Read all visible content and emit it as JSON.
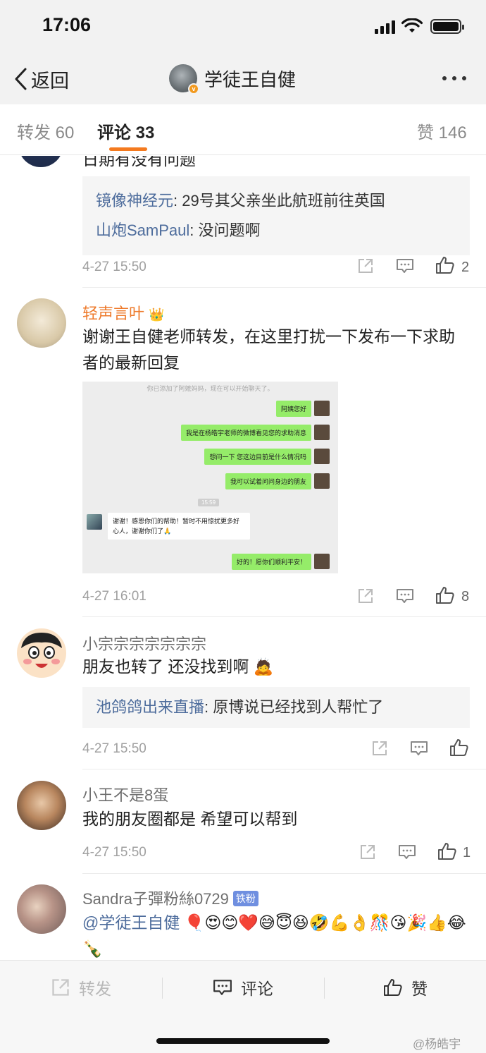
{
  "status_bar": {
    "time": "17:06"
  },
  "nav": {
    "back_label": "返回",
    "title": "学徒王自健"
  },
  "tabs": [
    {
      "label": "转发 60"
    },
    {
      "label": "评论 33"
    },
    {
      "label": "赞 146"
    }
  ],
  "comments": [
    {
      "text_cut": "日期有没有问题",
      "replies": [
        {
          "name": "镜像神经元",
          "text": ": 29号其父亲坐此航班前往英国"
        },
        {
          "name": "山炮SamPaul",
          "text": ": 没问题啊"
        }
      ],
      "time": "4-27 15:50",
      "likes": "2"
    },
    {
      "name": "轻声言叶",
      "text": "谢谢王自健老师转发，在这里打扰一下发布一下求助者的最新回复",
      "chat": {
        "system": "你已添加了阿嬷妈妈，现在可以开始聊天了。",
        "messages": [
          "阿姨您好",
          "我是在杨皓宇老师的微博看见您的求助消息",
          "想问一下 您这边目前是什么情况吗",
          "我可以试着问问身边的朋友"
        ],
        "timestamp": "15:59",
        "reply": "谢谢！感恩你们的帮助！暂时不用惊扰更多好心人，谢谢你们了🙏",
        "final": "好的！愿你们顺利平安！"
      },
      "time": "4-27 16:01",
      "likes": "8"
    },
    {
      "name": "小宗宗宗宗宗宗宗",
      "text": "朋友也转了 还没找到啊 🙇",
      "replies": [
        {
          "name": "池鸽鸽出来直播",
          "text": ": 原博说已经找到人帮忙了"
        }
      ],
      "time": "4-27 15:50"
    },
    {
      "name": "小王不是8蛋",
      "text": "我的朋友圈都是 希望可以帮到",
      "time": "4-27 15:50",
      "likes": "1"
    },
    {
      "name": "Sandra子彈粉絲0729",
      "badge": "铁粉",
      "mention": "@学徒王自健",
      "emojis": "🎈😍😊❤️😅😇😆🤣💪👌🎊😘🎉👍😂🍾"
    }
  ],
  "bottom_bar": {
    "repost": "转发",
    "comment": "评论",
    "like": "赞"
  },
  "watermark": "@杨皓宇",
  "colors": {
    "accent": "#f47a1f",
    "link": "#4d6c9c",
    "orange_name": "#ee7a2b"
  }
}
